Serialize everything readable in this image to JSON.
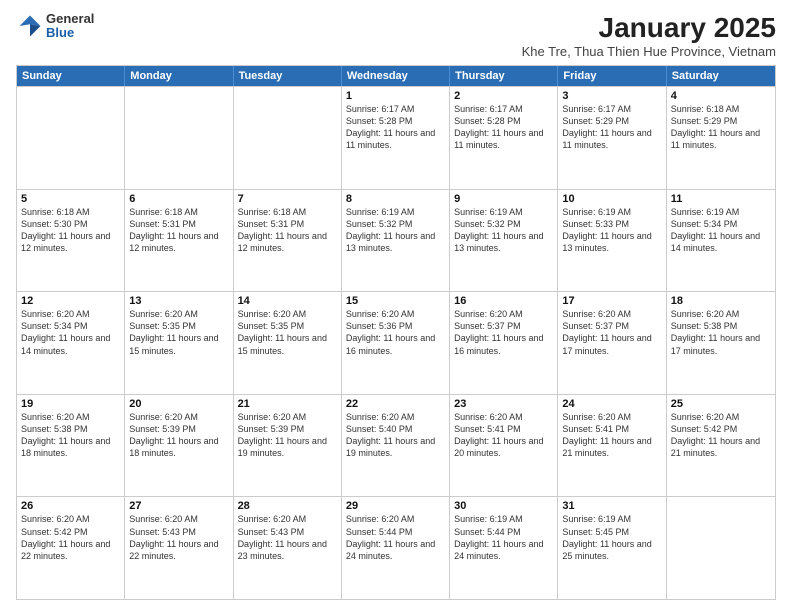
{
  "logo": {
    "general": "General",
    "blue": "Blue"
  },
  "title": "January 2025",
  "subtitle": "Khe Tre, Thua Thien Hue Province, Vietnam",
  "header_days": [
    "Sunday",
    "Monday",
    "Tuesday",
    "Wednesday",
    "Thursday",
    "Friday",
    "Saturday"
  ],
  "weeks": [
    [
      {
        "day": "",
        "text": ""
      },
      {
        "day": "",
        "text": ""
      },
      {
        "day": "",
        "text": ""
      },
      {
        "day": "1",
        "text": "Sunrise: 6:17 AM\nSunset: 5:28 PM\nDaylight: 11 hours and 11 minutes."
      },
      {
        "day": "2",
        "text": "Sunrise: 6:17 AM\nSunset: 5:28 PM\nDaylight: 11 hours and 11 minutes."
      },
      {
        "day": "3",
        "text": "Sunrise: 6:17 AM\nSunset: 5:29 PM\nDaylight: 11 hours and 11 minutes."
      },
      {
        "day": "4",
        "text": "Sunrise: 6:18 AM\nSunset: 5:29 PM\nDaylight: 11 hours and 11 minutes."
      }
    ],
    [
      {
        "day": "5",
        "text": "Sunrise: 6:18 AM\nSunset: 5:30 PM\nDaylight: 11 hours and 12 minutes."
      },
      {
        "day": "6",
        "text": "Sunrise: 6:18 AM\nSunset: 5:31 PM\nDaylight: 11 hours and 12 minutes."
      },
      {
        "day": "7",
        "text": "Sunrise: 6:18 AM\nSunset: 5:31 PM\nDaylight: 11 hours and 12 minutes."
      },
      {
        "day": "8",
        "text": "Sunrise: 6:19 AM\nSunset: 5:32 PM\nDaylight: 11 hours and 13 minutes."
      },
      {
        "day": "9",
        "text": "Sunrise: 6:19 AM\nSunset: 5:32 PM\nDaylight: 11 hours and 13 minutes."
      },
      {
        "day": "10",
        "text": "Sunrise: 6:19 AM\nSunset: 5:33 PM\nDaylight: 11 hours and 13 minutes."
      },
      {
        "day": "11",
        "text": "Sunrise: 6:19 AM\nSunset: 5:34 PM\nDaylight: 11 hours and 14 minutes."
      }
    ],
    [
      {
        "day": "12",
        "text": "Sunrise: 6:20 AM\nSunset: 5:34 PM\nDaylight: 11 hours and 14 minutes."
      },
      {
        "day": "13",
        "text": "Sunrise: 6:20 AM\nSunset: 5:35 PM\nDaylight: 11 hours and 15 minutes."
      },
      {
        "day": "14",
        "text": "Sunrise: 6:20 AM\nSunset: 5:35 PM\nDaylight: 11 hours and 15 minutes."
      },
      {
        "day": "15",
        "text": "Sunrise: 6:20 AM\nSunset: 5:36 PM\nDaylight: 11 hours and 16 minutes."
      },
      {
        "day": "16",
        "text": "Sunrise: 6:20 AM\nSunset: 5:37 PM\nDaylight: 11 hours and 16 minutes."
      },
      {
        "day": "17",
        "text": "Sunrise: 6:20 AM\nSunset: 5:37 PM\nDaylight: 11 hours and 17 minutes."
      },
      {
        "day": "18",
        "text": "Sunrise: 6:20 AM\nSunset: 5:38 PM\nDaylight: 11 hours and 17 minutes."
      }
    ],
    [
      {
        "day": "19",
        "text": "Sunrise: 6:20 AM\nSunset: 5:38 PM\nDaylight: 11 hours and 18 minutes."
      },
      {
        "day": "20",
        "text": "Sunrise: 6:20 AM\nSunset: 5:39 PM\nDaylight: 11 hours and 18 minutes."
      },
      {
        "day": "21",
        "text": "Sunrise: 6:20 AM\nSunset: 5:39 PM\nDaylight: 11 hours and 19 minutes."
      },
      {
        "day": "22",
        "text": "Sunrise: 6:20 AM\nSunset: 5:40 PM\nDaylight: 11 hours and 19 minutes."
      },
      {
        "day": "23",
        "text": "Sunrise: 6:20 AM\nSunset: 5:41 PM\nDaylight: 11 hours and 20 minutes."
      },
      {
        "day": "24",
        "text": "Sunrise: 6:20 AM\nSunset: 5:41 PM\nDaylight: 11 hours and 21 minutes."
      },
      {
        "day": "25",
        "text": "Sunrise: 6:20 AM\nSunset: 5:42 PM\nDaylight: 11 hours and 21 minutes."
      }
    ],
    [
      {
        "day": "26",
        "text": "Sunrise: 6:20 AM\nSunset: 5:42 PM\nDaylight: 11 hours and 22 minutes."
      },
      {
        "day": "27",
        "text": "Sunrise: 6:20 AM\nSunset: 5:43 PM\nDaylight: 11 hours and 22 minutes."
      },
      {
        "day": "28",
        "text": "Sunrise: 6:20 AM\nSunset: 5:43 PM\nDaylight: 11 hours and 23 minutes."
      },
      {
        "day": "29",
        "text": "Sunrise: 6:20 AM\nSunset: 5:44 PM\nDaylight: 11 hours and 24 minutes."
      },
      {
        "day": "30",
        "text": "Sunrise: 6:19 AM\nSunset: 5:44 PM\nDaylight: 11 hours and 24 minutes."
      },
      {
        "day": "31",
        "text": "Sunrise: 6:19 AM\nSunset: 5:45 PM\nDaylight: 11 hours and 25 minutes."
      },
      {
        "day": "",
        "text": ""
      }
    ]
  ]
}
